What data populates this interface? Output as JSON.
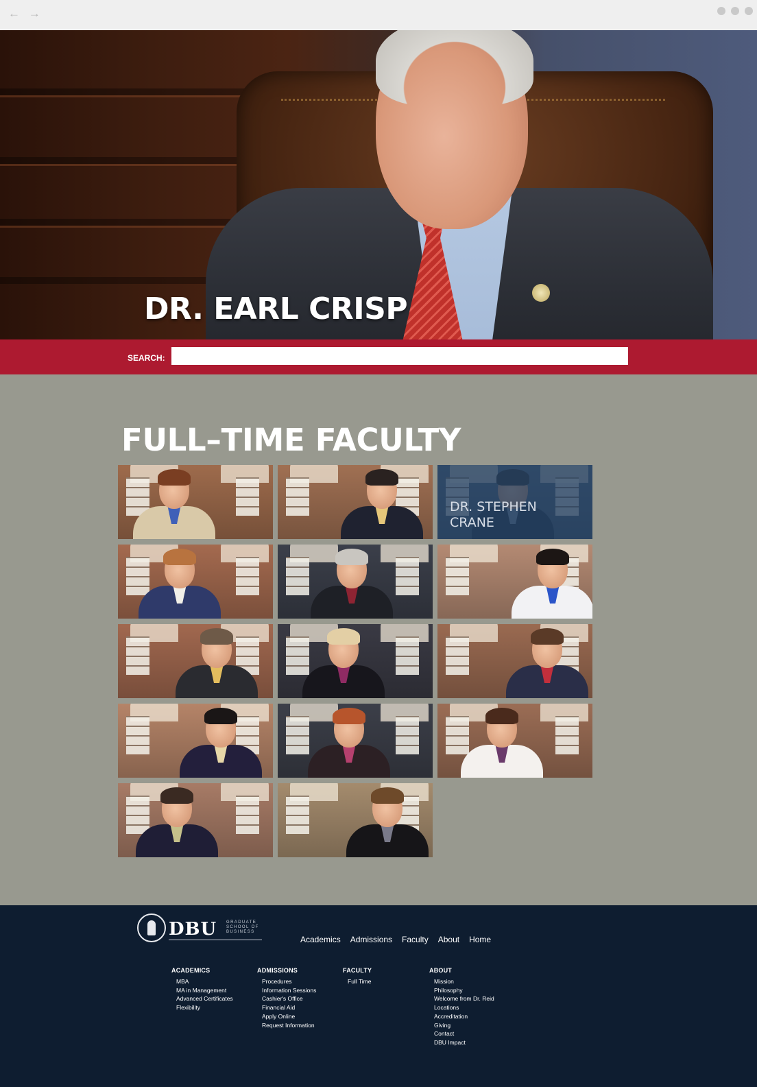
{
  "chrome": {
    "back": "←",
    "forward": "→"
  },
  "hero": {
    "title": "DR. EARL CRISP"
  },
  "search": {
    "label": "SEARCH:",
    "value": "",
    "placeholder": ""
  },
  "faculty": {
    "title": "FULL–TIME FACULTY",
    "tiles": [
      {
        "highlighted": false,
        "name": "",
        "bg": "#9e6b4c",
        "suit": "#d9c9a8",
        "shirt": "#3f60b8",
        "hair": "#7a3e22"
      },
      {
        "highlighted": false,
        "name": "",
        "bg": "#a07053",
        "suit": "#1f2230",
        "shirt": "#e6c77a",
        "hair": "#2a2220"
      },
      {
        "highlighted": true,
        "name": "DR. STEPHEN CRANE",
        "bg": "#566a80",
        "suit": "#1e2a3c",
        "shirt": "#7d8ea6",
        "hair": "#2b2a2a"
      },
      {
        "highlighted": false,
        "name": "",
        "bg": "#a46a4f",
        "suit": "#2f3a6a",
        "shirt": "#f1efe8",
        "hair": "#b8733f"
      },
      {
        "highlighted": false,
        "name": "",
        "bg": "#3b3f4a",
        "suit": "#1e2026",
        "shirt": "#8e2433",
        "hair": "#c9c6c0"
      },
      {
        "highlighted": false,
        "name": "",
        "bg": "#b48a73",
        "suit": "#f2f2f4",
        "shirt": "#2b55c9",
        "hair": "#1c1614"
      },
      {
        "highlighted": false,
        "name": "",
        "bg": "#a1684f",
        "suit": "#2a2b30",
        "shirt": "#e3bd5e",
        "hair": "#6e5a48"
      },
      {
        "highlighted": false,
        "name": "",
        "bg": "#3a3a44",
        "suit": "#17161c",
        "shirt": "#8f2b63",
        "hair": "#e3cfa5"
      },
      {
        "highlighted": false,
        "name": "",
        "bg": "#9a6a51",
        "suit": "#2a2e48",
        "shirt": "#c22f3c",
        "hair": "#5a3a27"
      },
      {
        "highlighted": false,
        "name": "",
        "bg": "#b58468",
        "suit": "#231f3c",
        "shirt": "#e7d7a8",
        "hair": "#1a1616"
      },
      {
        "highlighted": false,
        "name": "",
        "bg": "#3c3f49",
        "suit": "#2c2024",
        "shirt": "#b6406e",
        "hair": "#b7552c"
      },
      {
        "highlighted": false,
        "name": "",
        "bg": "#9b6d55",
        "suit": "#f4f1ee",
        "shirt": "#6a3a6a",
        "hair": "#4a2a1c"
      },
      {
        "highlighted": false,
        "name": "",
        "bg": "#a77b66",
        "suit": "#1f1e36",
        "shirt": "#c5c08a",
        "hair": "#3a2a22"
      },
      {
        "highlighted": false,
        "name": "",
        "bg": "#a48b6d",
        "suit": "#161518",
        "shirt": "#7a7a8a",
        "hair": "#6e4a2a"
      }
    ]
  },
  "footer": {
    "logo": {
      "mark": "DBU",
      "subtitle": "GRADUATE SCHOOL OF BUSINESS"
    },
    "topnav": [
      "Academics",
      "Admissions",
      "Faculty",
      "About",
      "Home"
    ],
    "columns": [
      {
        "heading": "ACADEMICS",
        "items": [
          "MBA",
          "MA in Management",
          "Advanced Certificates",
          "Flexibility"
        ]
      },
      {
        "heading": "ADMISSIONS",
        "items": [
          "Procedures",
          "Information Sessions",
          "Cashier's Office",
          "Financial Aid",
          "Apply Online",
          "Request Information"
        ]
      },
      {
        "heading": "FACULTY",
        "items": [
          "Full Time"
        ]
      },
      {
        "heading": "ABOUT",
        "items": [
          "Mission",
          "Philosophy",
          "Welcome from Dr. Reid",
          "Locations",
          "Accreditation",
          "Giving",
          "Contact",
          "DBU Impact"
        ]
      }
    ]
  }
}
